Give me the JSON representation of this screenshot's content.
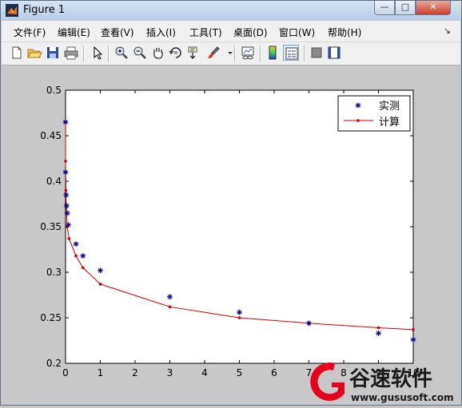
{
  "window": {
    "title": "Figure 1",
    "minimize_label": "—",
    "maximize_label": "□",
    "close_label": "✕"
  },
  "menu": {
    "items": [
      {
        "label": "文件(F)"
      },
      {
        "label": "编辑(E)"
      },
      {
        "label": "查看(V)"
      },
      {
        "label": "插入(I)"
      },
      {
        "label": "工具(T)"
      },
      {
        "label": "桌面(D)"
      },
      {
        "label": "窗口(W)"
      },
      {
        "label": "帮助(H)"
      }
    ],
    "corner": "↘"
  },
  "toolbar": {
    "icons": [
      "new-figure-icon",
      "open-file-icon",
      "save-icon",
      "print-icon",
      "edit-plot-arrow-icon",
      "zoom-in-icon",
      "zoom-out-icon",
      "pan-hand-icon",
      "rotate-3d-icon",
      "data-cursor-icon",
      "brush-icon",
      "link-plot-icon",
      "colorbar-icon",
      "legend-icon",
      "hide-plot-tools-icon",
      "show-plot-tools-icon"
    ]
  },
  "chart_data": {
    "type": "scatter",
    "title": "",
    "xlabel": "",
    "ylabel": "",
    "xlim": [
      0,
      10
    ],
    "ylim": [
      0.2,
      0.5
    ],
    "xticks": [
      0,
      1,
      2,
      3,
      4,
      5,
      6,
      7,
      8,
      9,
      10
    ],
    "yticks": [
      0.2,
      0.25,
      0.3,
      0.35,
      0.4,
      0.45,
      0.5
    ],
    "xtick_labels": [
      "0",
      "1",
      "2",
      "3",
      "4",
      "5",
      "6",
      "7",
      "8",
      "9",
      "10"
    ],
    "ytick_labels": [
      "0.2",
      "0.25",
      "0.3",
      "0.35",
      "0.4",
      "0.45",
      "0.5"
    ],
    "grid": false,
    "legend_position": "top-right",
    "series": [
      {
        "name": "实测",
        "marker": "asterisk",
        "color": "#00008b",
        "x": [
          0.0,
          0.0,
          0.02,
          0.03,
          0.05,
          0.08,
          0.3,
          0.5,
          1,
          3,
          5,
          7,
          9,
          10
        ],
        "y": [
          0.465,
          0.41,
          0.385,
          0.373,
          0.365,
          0.352,
          0.331,
          0.318,
          0.302,
          0.273,
          0.256,
          0.244,
          0.233,
          0.226
        ]
      },
      {
        "name": "计算",
        "marker": "dot-line",
        "color": "#cc0000",
        "x": [
          0.0,
          0.0,
          0.01,
          0.02,
          0.05,
          0.1,
          0.3,
          0.5,
          1,
          3,
          5,
          7,
          9,
          10
        ],
        "y": [
          0.465,
          0.422,
          0.39,
          0.372,
          0.35,
          0.337,
          0.318,
          0.305,
          0.287,
          0.262,
          0.25,
          0.244,
          0.239,
          0.237
        ]
      }
    ]
  },
  "watermark": {
    "brand": "谷速软件",
    "url": "www.gususoft.com",
    "accent": "#e6001e"
  }
}
